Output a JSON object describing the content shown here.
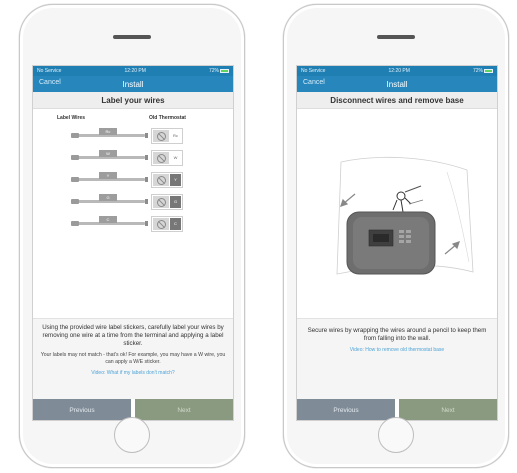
{
  "left_screen": {
    "status": {
      "carrier": "No Service",
      "time": "12:20 PM",
      "battery": "72%"
    },
    "nav": {
      "cancel": "Cancel",
      "title": "Install"
    },
    "header": "Label your wires",
    "columns": {
      "label_wires": "Label Wires",
      "old_thermostat": "Old Thermostat"
    },
    "rows": [
      {
        "tag": "Rc",
        "terminal": "Rc",
        "terminal_dark": false
      },
      {
        "tag": "W",
        "terminal": "W",
        "terminal_dark": false
      },
      {
        "tag": "Y",
        "terminal": "Y",
        "terminal_dark": true
      },
      {
        "tag": "G",
        "terminal": "G",
        "terminal_dark": true
      },
      {
        "tag": "C",
        "terminal": "C",
        "terminal_dark": true
      }
    ],
    "instruction": "Using the provided wire label stickers, carefully label your wires by removing one wire at a time from the terminal and applying a label sticker.",
    "note": "Your labels may not match - that's ok! For example, you may have a W wire, you can apply a W/E sticker.",
    "link": "Video: What if my labels don't match?",
    "buttons": {
      "previous": "Previous",
      "next": "Next"
    }
  },
  "right_screen": {
    "status": {
      "carrier": "No Service",
      "time": "12:20 PM",
      "battery": "72%"
    },
    "nav": {
      "cancel": "Cancel",
      "title": "Install"
    },
    "header": "Disconnect wires and remove base",
    "instruction": "Secure wires by wrapping the wires around a pencil to keep them from falling into the wall.",
    "link": "Video: How to remove old thermostat base",
    "buttons": {
      "previous": "Previous",
      "next": "Next"
    }
  },
  "colors": {
    "nav_blue": "#2787bd",
    "previous_btn": "#7f8c98",
    "next_btn": "#8a9a80",
    "link": "#4da3d6"
  }
}
